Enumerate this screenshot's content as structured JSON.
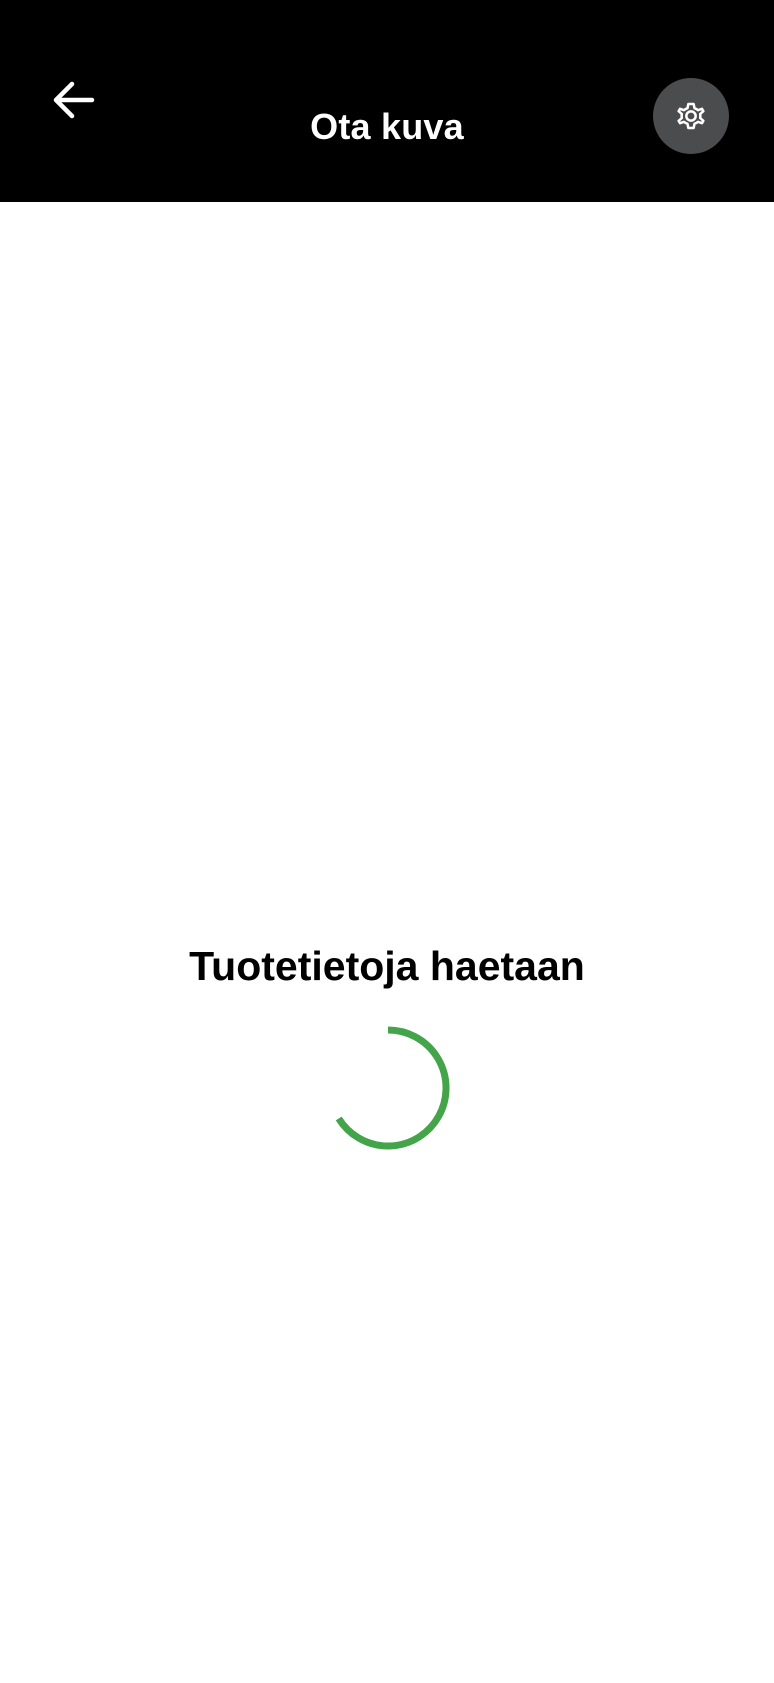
{
  "header": {
    "title": "Ota kuva",
    "back_icon": "arrow-left-icon",
    "settings_icon": "gear-icon",
    "background_color": "#000000",
    "settings_button_color": "#4b4c4e"
  },
  "main": {
    "loading_text": "Tuotetietoja haetaan",
    "spinner_color": "#43a44a"
  }
}
